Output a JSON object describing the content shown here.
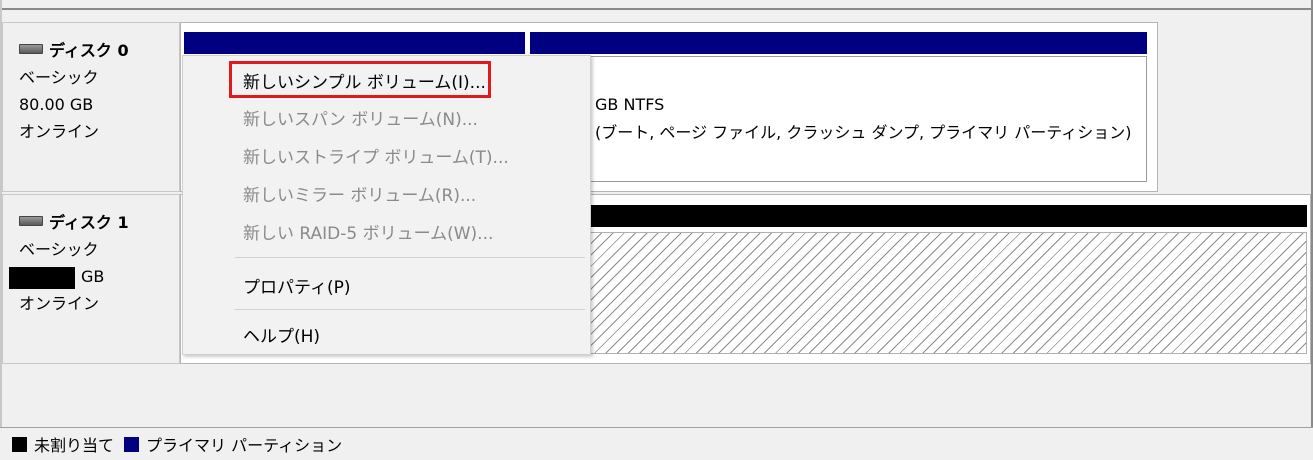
{
  "disks": [
    {
      "name": "ディスク 0",
      "type": "ベーシック",
      "size": "80.00 GB",
      "status": "オンライン"
    },
    {
      "name": "ディスク 1",
      "type": "ベーシック",
      "size": "GB",
      "status": "オンライン"
    }
  ],
  "partition": {
    "line1": "GB NTFS",
    "line2": "(ブート, ページ ファイル, クラッシュ ダンプ, プライマリ パーティション)"
  },
  "context_menu": {
    "items": [
      {
        "label": "新しいシンプル ボリューム(I)...",
        "enabled": true
      },
      {
        "label": "新しいスパン ボリューム(N)...",
        "enabled": false
      },
      {
        "label": "新しいストライプ ボリューム(T)...",
        "enabled": false
      },
      {
        "label": "新しいミラー ボリューム(R)...",
        "enabled": false
      },
      {
        "label": "新しい RAID-5 ボリューム(W)...",
        "enabled": false
      },
      {
        "label": "プロパティ(P)",
        "enabled": true
      },
      {
        "label": "ヘルプ(H)",
        "enabled": true
      }
    ]
  },
  "legend": {
    "unallocated": "未割り当て",
    "primary": "プライマリ パーティション"
  },
  "colors": {
    "primary_partition": "#000080",
    "unallocated": "#000000",
    "highlight_box": "#e0191e"
  }
}
